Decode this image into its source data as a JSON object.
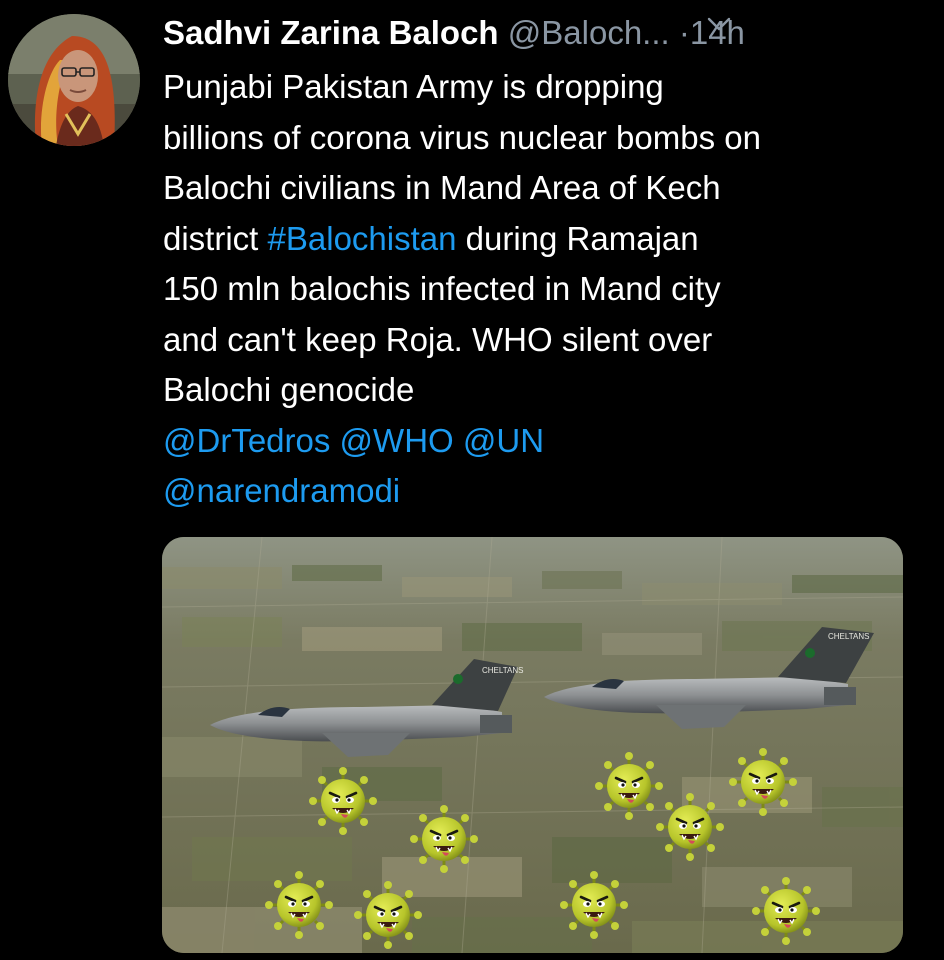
{
  "tweet": {
    "display_name": "Sadhvi Zarina Baloch",
    "handle": "@Baloch...",
    "separator": "·",
    "timestamp": "14h",
    "text_lines": [
      {
        "before": "Punjabi Pakistan Army is dropping",
        "link": "",
        "after": ""
      },
      {
        "before": "billions of corona virus nuclear bombs on",
        "link": "",
        "after": ""
      },
      {
        "before": "Balochi civilians in Mand Area of Kech",
        "link": "",
        "after": ""
      },
      {
        "before": "district ",
        "link": "#Balochistan",
        "after": " during Ramajan"
      },
      {
        "before": "150 mln balochis infected in Mand city",
        "link": "",
        "after": ""
      },
      {
        "before": "and can't keep Roja. WHO silent over",
        "link": "",
        "after": ""
      },
      {
        "before": "Balochi genocide",
        "link": "",
        "after": ""
      }
    ],
    "mentions_line_1": [
      "@DrTedros",
      "@WHO",
      "@UN"
    ],
    "mentions_line_2": [
      "@narendramodi"
    ],
    "jet_tail_text": "CHELTANS"
  },
  "icons": {
    "caret": "chevron-down-icon",
    "avatar": "avatar"
  },
  "colors": {
    "background": "#000000",
    "text": "#ffffff",
    "secondary": "#8a96a3",
    "link": "#1d9bf0",
    "virus": "#b8c62a"
  }
}
